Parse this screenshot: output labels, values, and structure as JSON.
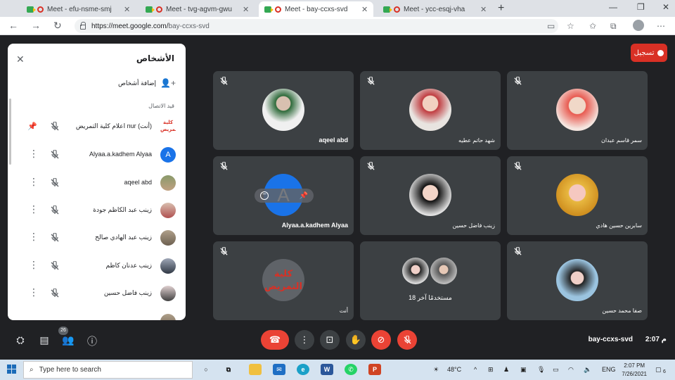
{
  "browser": {
    "tabs": [
      {
        "title": "Meet - efu-nsme-smj"
      },
      {
        "title": "Meet - tvg-agvm-gwu"
      },
      {
        "title": "Meet - bay-ccxs-svd"
      },
      {
        "title": "Meet - ycc-esqj-vha"
      }
    ],
    "url_host": "https://meet.google.com/",
    "url_path": "bay-ccxs-svd"
  },
  "panel": {
    "title": "الأشخاص",
    "add_people": "إضافة أشخاص",
    "section_label": "قيد الاتصال",
    "participants": [
      {
        "name": "اعلام كلية التمريض nur (أنت)",
        "avatar_text": "كلية التمريض"
      },
      {
        "name": "Alyaa.a.kadhem Alyaa",
        "avatar_text": "A"
      },
      {
        "name": "aqeel abd"
      },
      {
        "name": "زينب عبد الكاظم جودة"
      },
      {
        "name": "زينب عبد الهادي صالح"
      },
      {
        "name": "زينب عدنان كاظم"
      },
      {
        "name": "زينب فاضل حسين"
      }
    ]
  },
  "record": {
    "label": "تسجيل"
  },
  "tiles": [
    {
      "name": "aqeel abd"
    },
    {
      "name": "شهد حاتم عطيه"
    },
    {
      "name": "سمر قاسم عبدان"
    },
    {
      "name": "Alyaa.a.kadhem Alyaa",
      "avatar_text": "A"
    },
    {
      "name": "زينب فاضل حسين"
    },
    {
      "name": "سابرين حسين هادي"
    },
    {
      "name": "أنت",
      "avatar_text": "كلية التمريض"
    },
    {
      "name": "18 مستخدمًا آخر"
    },
    {
      "name": "صفا محمد حسين"
    }
  ],
  "bottom": {
    "people_count": "26",
    "meeting_code": "bay-ccxs-svd",
    "time": "2:07 م"
  },
  "taskbar": {
    "search_placeholder": "Type here to search",
    "weather": "48°C",
    "lang": "ENG",
    "clock_time": "2:07 PM",
    "clock_date": "7/26/2021",
    "notif_count": "6"
  },
  "colors": {
    "accent_red": "#ea4335",
    "tile_bg": "#3c4043",
    "meet_bg": "#202124",
    "avatar_blue": "#1a73e8"
  }
}
